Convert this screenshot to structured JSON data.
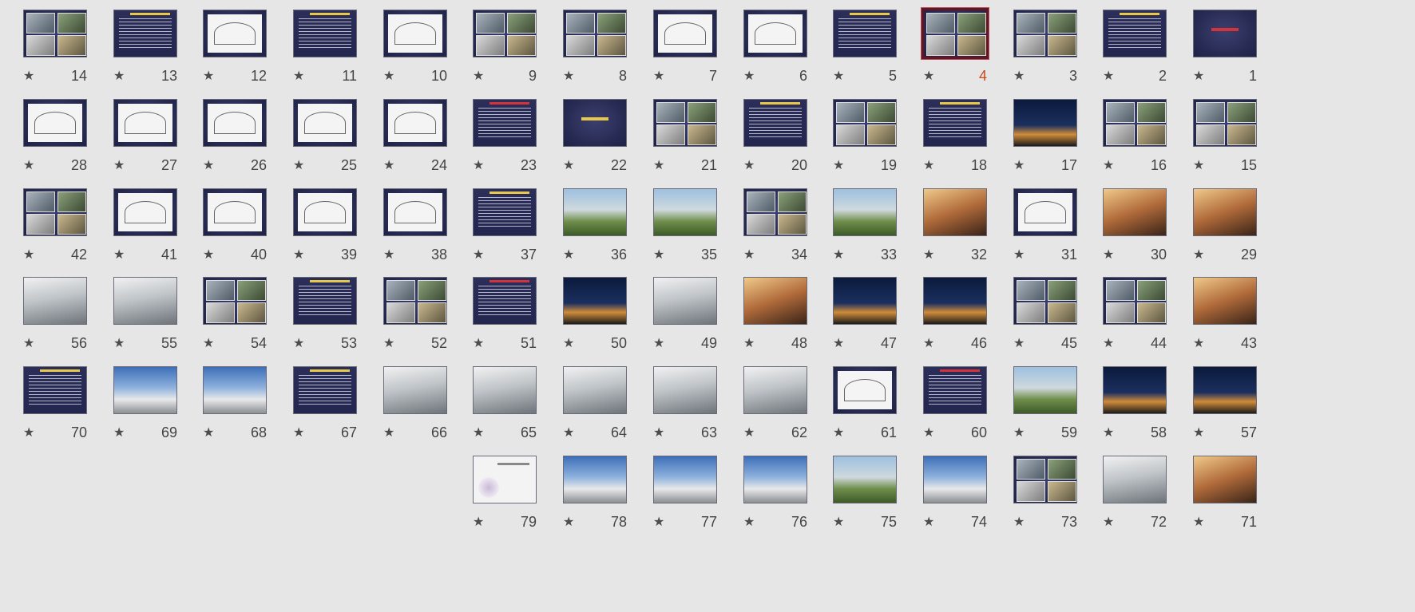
{
  "view": "slide-sorter",
  "selected_slide": 4,
  "star_glyph": "★",
  "colors": {
    "background": "#e6e6e6",
    "selected_border": "#6a1320",
    "selected_number": "#c54a1d",
    "number": "#444444"
  },
  "slides": [
    {
      "number": "1",
      "kind": "title-red"
    },
    {
      "number": "2",
      "kind": "text"
    },
    {
      "number": "3",
      "kind": "collage"
    },
    {
      "number": "4",
      "kind": "collage",
      "selected": true
    },
    {
      "number": "5",
      "kind": "text"
    },
    {
      "number": "6",
      "kind": "sketch"
    },
    {
      "number": "7",
      "kind": "sketch"
    },
    {
      "number": "8",
      "kind": "collage"
    },
    {
      "number": "9",
      "kind": "collage"
    },
    {
      "number": "10",
      "kind": "sketch"
    },
    {
      "number": "11",
      "kind": "text"
    },
    {
      "number": "12",
      "kind": "sketch"
    },
    {
      "number": "13",
      "kind": "text"
    },
    {
      "number": "14",
      "kind": "collage"
    },
    {
      "number": "15",
      "kind": "collage"
    },
    {
      "number": "16",
      "kind": "collage"
    },
    {
      "number": "17",
      "kind": "photo-night"
    },
    {
      "number": "18",
      "kind": "text"
    },
    {
      "number": "19",
      "kind": "collage"
    },
    {
      "number": "20",
      "kind": "text"
    },
    {
      "number": "21",
      "kind": "collage"
    },
    {
      "number": "22",
      "kind": "title"
    },
    {
      "number": "23",
      "kind": "text-red"
    },
    {
      "number": "24",
      "kind": "sketch"
    },
    {
      "number": "25",
      "kind": "sketch"
    },
    {
      "number": "26",
      "kind": "sketch"
    },
    {
      "number": "27",
      "kind": "sketch"
    },
    {
      "number": "28",
      "kind": "sketch"
    },
    {
      "number": "29",
      "kind": "photo-warm"
    },
    {
      "number": "30",
      "kind": "photo-warm"
    },
    {
      "number": "31",
      "kind": "sketch"
    },
    {
      "number": "32",
      "kind": "photo-warm"
    },
    {
      "number": "33",
      "kind": "photo-green"
    },
    {
      "number": "34",
      "kind": "collage"
    },
    {
      "number": "35",
      "kind": "photo-green"
    },
    {
      "number": "36",
      "kind": "photo-green"
    },
    {
      "number": "37",
      "kind": "text"
    },
    {
      "number": "38",
      "kind": "sketch"
    },
    {
      "number": "39",
      "kind": "sketch"
    },
    {
      "number": "40",
      "kind": "sketch"
    },
    {
      "number": "41",
      "kind": "sketch"
    },
    {
      "number": "42",
      "kind": "collage"
    },
    {
      "number": "43",
      "kind": "photo-warm"
    },
    {
      "number": "44",
      "kind": "collage"
    },
    {
      "number": "45",
      "kind": "collage"
    },
    {
      "number": "46",
      "kind": "photo-night"
    },
    {
      "number": "47",
      "kind": "photo-night"
    },
    {
      "number": "48",
      "kind": "photo-warm"
    },
    {
      "number": "49",
      "kind": "photo-grey"
    },
    {
      "number": "50",
      "kind": "photo-night"
    },
    {
      "number": "51",
      "kind": "text-red"
    },
    {
      "number": "52",
      "kind": "collage"
    },
    {
      "number": "53",
      "kind": "text"
    },
    {
      "number": "54",
      "kind": "collage"
    },
    {
      "number": "55",
      "kind": "photo-grey"
    },
    {
      "number": "56",
      "kind": "photo-grey"
    },
    {
      "number": "57",
      "kind": "photo-night"
    },
    {
      "number": "58",
      "kind": "photo-night"
    },
    {
      "number": "59",
      "kind": "photo-green"
    },
    {
      "number": "60",
      "kind": "text-red"
    },
    {
      "number": "61",
      "kind": "sketch"
    },
    {
      "number": "62",
      "kind": "photo-grey"
    },
    {
      "number": "63",
      "kind": "photo-grey"
    },
    {
      "number": "64",
      "kind": "photo-grey"
    },
    {
      "number": "65",
      "kind": "photo-grey"
    },
    {
      "number": "66",
      "kind": "photo-grey"
    },
    {
      "number": "67",
      "kind": "text"
    },
    {
      "number": "68",
      "kind": "photo-blue"
    },
    {
      "number": "69",
      "kind": "photo-blue"
    },
    {
      "number": "70",
      "kind": "text"
    },
    {
      "number": "71",
      "kind": "photo-warm"
    },
    {
      "number": "72",
      "kind": "photo-grey"
    },
    {
      "number": "73",
      "kind": "collage"
    },
    {
      "number": "74",
      "kind": "photo-blue"
    },
    {
      "number": "75",
      "kind": "photo-green"
    },
    {
      "number": "76",
      "kind": "photo-blue"
    },
    {
      "number": "77",
      "kind": "photo-blue"
    },
    {
      "number": "78",
      "kind": "photo-blue"
    },
    {
      "number": "79",
      "kind": "end"
    }
  ]
}
